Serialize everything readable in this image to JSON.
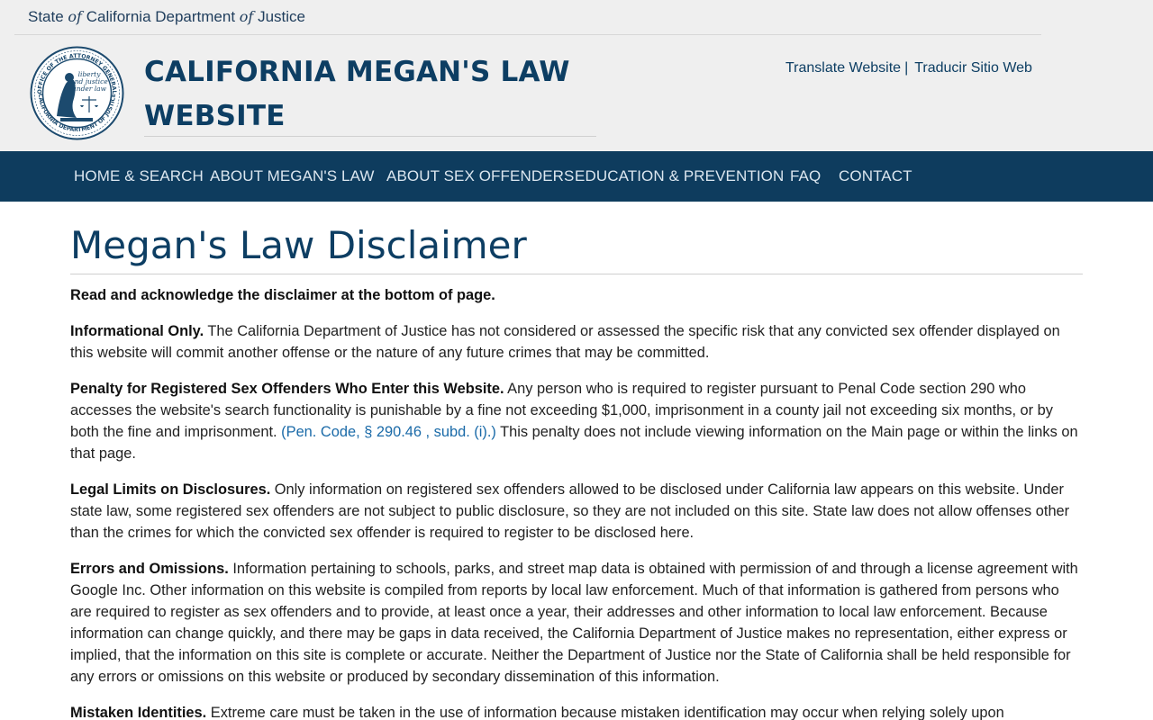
{
  "header": {
    "doj_prefix": "State ",
    "doj_of1": "of",
    "doj_mid": " California Department ",
    "doj_of2": "of",
    "doj_suffix": " Justice",
    "seal_name": "california-doj-seal",
    "seal_text": "Liberty and Justice under law",
    "site_title_line1": "CALIFORNIA MEGAN'S LAW",
    "site_title_line2": "WEBSITE",
    "translate_link": "Translate Website",
    "separator": "|",
    "traducir_link": "Traducir Sitio Web"
  },
  "nav": {
    "items": [
      {
        "label": "HOME & SEARCH"
      },
      {
        "label": "ABOUT MEGAN'S LAW"
      },
      {
        "label": "ABOUT SEX OFFENDERS"
      },
      {
        "label": "EDUCATION & PREVENTION"
      },
      {
        "label": "FAQ"
      },
      {
        "label": "CONTACT"
      }
    ]
  },
  "main": {
    "title": "Megan's Law Disclaimer",
    "intro": "Read and acknowledge the disclaimer at the bottom of page.",
    "sections": [
      {
        "heading": "Informational Only.",
        "text": " The California Department of Justice has not considered or assessed the specific risk that any convicted sex offender displayed on this website will commit another offense or the nature of any future crimes that may be committed."
      },
      {
        "heading": "Penalty for Registered Sex Offenders Who Enter this Website.",
        "text": " Any person who is required to register pursuant to Penal Code section 290 who accesses the website's search functionality is punishable by a fine not exceeding $1,000, imprisonment in a county jail not exceeding six months, or by both the fine and imprisonment. ",
        "link": "(Pen. Code, § 290.46 , subd. (i).)",
        "text_after": " This penalty does not include viewing information on the Main page or within the links on that page."
      },
      {
        "heading": "Legal Limits on Disclosures.",
        "text": " Only information on registered sex offenders allowed to be disclosed under California law appears on this website. Under state law, some registered sex offenders are not subject to public disclosure, so they are not included on this site. State law does not allow offenses other than the crimes for which the convicted sex offender is required to register to be disclosed here."
      },
      {
        "heading": "Errors and Omissions.",
        "text": " Information pertaining to schools, parks, and street map data is obtained with permission of and through a license agreement with Google Inc. Other information on this website is compiled from reports by local law enforcement. Much of that information is gathered from persons who are required to register as sex offenders and to provide, at least once a year, their addresses and other information to local law enforcement. Because information can change quickly, and there may be gaps in data received, the California Department of Justice makes no representation, either express or implied, that the information on this site is complete or accurate. Neither the Department of Justice nor the State of California shall be held responsible for any errors or omissions on this website or produced by secondary dissemination of this information."
      },
      {
        "heading": "Mistaken Identities.",
        "text": " Extreme care must be taken in the use of information because mistaken identification may occur when relying solely upon"
      }
    ]
  },
  "colors": {
    "header_bg": "#efefef",
    "nav_bg": "#0e3c5e",
    "title_color": "#0d3e63",
    "link_color": "#1a6aa8"
  }
}
